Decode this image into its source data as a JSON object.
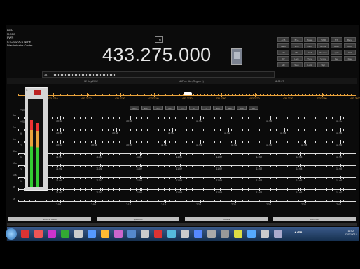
{
  "left_info": {
    "lines": [
      "AGC",
      "MODE",
      "PWR",
      "CTCSS/DCS None",
      "Discriminator Center"
    ]
  },
  "frequency": {
    "value": "433.275.000",
    "tag": "TN"
  },
  "button_grid": [
    "A>B",
    "B>A",
    "Swap",
    "PWR",
    "TX",
    "Band",
    "MEM",
    "VFO",
    "ANT",
    "MODE",
    "Filter",
    "AGC",
    "NB",
    "NR",
    "ATT",
    "Preamp",
    "Split",
    "RIT",
    "XIT",
    "Lock",
    "Tune",
    "Scope",
    "Rec",
    "Play",
    "Mic",
    "Step",
    "Lock",
    "Spl"
  ],
  "signal": {
    "value": "34"
  },
  "header": {
    "date": "02 July 2012",
    "mode": "NBFm - 5kc (Region 1)",
    "time": "11:02:27"
  },
  "meter": {
    "label": "S",
    "cap": "PWR"
  },
  "orange_scale": [
    "433.2710",
    "433.2720",
    "433.2730",
    "433.2740",
    "433.2750",
    "433.2760",
    "433.2770",
    "433.2780",
    "433.2790",
    "433.2800"
  ],
  "span_buttons": [
    "100m",
    "50m",
    "25m",
    "10m",
    "5m",
    "2m",
    "1m",
    "500",
    "250",
    "100",
    "50"
  ],
  "rows": [
    {
      "label": "5m",
      "ticks": [
        "10:50",
        "10:55",
        "11:00",
        "11:05",
        "11:10"
      ]
    },
    {
      "label": "2m",
      "ticks": [
        "10:56",
        "10:58",
        "11:00",
        "11:02",
        "11:04",
        "11:06"
      ]
    },
    {
      "label": "1m",
      "ticks": [
        "10:57",
        "10:58",
        "10:59",
        "11:00",
        "11:01",
        "11:02",
        "11:03",
        "11:04",
        "11:05"
      ]
    },
    {
      "label": "30s",
      "ticks": [
        "11:00",
        "11:00",
        "11:01",
        "11:01",
        "11:02",
        "11:02",
        "11:03",
        "11:03"
      ]
    },
    {
      "label": "15s",
      "ticks": [
        "11:01",
        "11:01",
        "11:02",
        "11:02",
        "11:02",
        "11:02",
        "11:03",
        "11:03"
      ]
    },
    {
      "label": "10s",
      "ticks": [
        "11:01",
        "11:02",
        "11:02",
        "11:02",
        "11:02",
        "11:02",
        "11:02",
        "11:03"
      ]
    },
    {
      "label": "5s",
      "ticks": [
        "11:02",
        "11:02",
        "11:02",
        "11:02",
        "11:02",
        "11:02",
        "11:02",
        "11:02"
      ]
    },
    {
      "label": "1s",
      "ticks": [
        "7:00",
        "7:05",
        "7:10",
        "7:15",
        "7:20",
        "7:25",
        "7:30",
        "7:35",
        "7:40"
      ]
    }
  ],
  "meter_scale": [
    "+40",
    "+20",
    "9",
    "7",
    "5",
    "3",
    "1"
  ],
  "taskbar": {
    "clock_time": "11:02",
    "clock_date": "02/07/2012",
    "panels": [
      "ScanFM Radio",
      "Spectrum",
      "Timeline",
      "Recorder"
    ]
  },
  "colors": {
    "accent": "#e8a23c",
    "bg": "#000000"
  }
}
